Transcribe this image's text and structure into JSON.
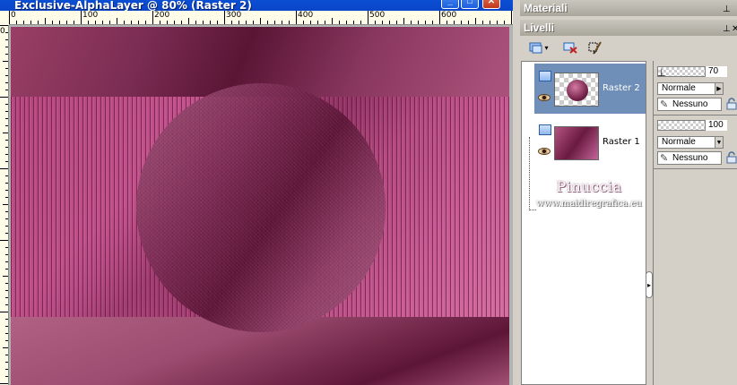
{
  "document": {
    "title": "Exclusive-AlphaLayer  @  80% (Raster 2)",
    "buttons": {
      "minimize": "_",
      "maximize": "□",
      "close": "✕"
    },
    "ruler_top_labels": [
      "0",
      "100",
      "200",
      "300",
      "400",
      "500",
      "600"
    ],
    "ruler_left_labels": [
      "0"
    ]
  },
  "panels": {
    "materials": {
      "title": "Materiali",
      "pin": "⊥"
    },
    "layers": {
      "title": "Livelli",
      "pin": "⊥",
      "close": "✕",
      "toolbar": [
        {
          "name": "new-layer-icon",
          "label": "▾"
        },
        {
          "name": "delete-layer-icon",
          "label": ""
        },
        {
          "name": "edit-selection-icon",
          "label": ""
        }
      ],
      "items": [
        {
          "name": "Raster 2",
          "selected": true,
          "opacity": "70",
          "blend": "Normale",
          "lock": "Nessuno"
        },
        {
          "name": "Raster 1",
          "selected": false,
          "opacity": "100",
          "blend": "Normale",
          "lock": "Nessuno"
        }
      ],
      "watermark": {
        "brand": "Pinuccia",
        "url": "www.maidiregrafica.eu"
      }
    }
  }
}
